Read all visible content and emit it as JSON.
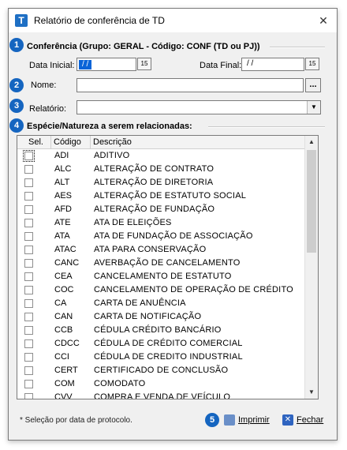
{
  "window": {
    "title": "Relatório de conferência de TD",
    "icon_letter": "T"
  },
  "badges": [
    "1",
    "2",
    "3",
    "4",
    "5"
  ],
  "section1": {
    "title": "Conferência (Grupo: GERAL - Código: CONF (TD ou PJ))",
    "data_inicial_label": "Data Inicial:",
    "data_inicial_value": " /  / ",
    "data_final_label": "Data Final:",
    "data_final_value": " /  / ",
    "calendar_glyph": "15"
  },
  "nome": {
    "label": "Nome:",
    "value": "",
    "browse_label": "..."
  },
  "relatorio": {
    "label": "Relatório:",
    "value": ""
  },
  "section4": {
    "title": "Espécie/Natureza a serem relacionadas:"
  },
  "grid": {
    "headers": {
      "sel": "Sel.",
      "codigo": "Código",
      "descricao": "Descrição"
    },
    "rows": [
      {
        "code": "ADI",
        "desc": "ADITIVO"
      },
      {
        "code": "ALC",
        "desc": "ALTERAÇÃO DE CONTRATO"
      },
      {
        "code": "ALT",
        "desc": "ALTERAÇÃO DE DIRETORIA"
      },
      {
        "code": "AES",
        "desc": "ALTERAÇÃO DE ESTATUTO SOCIAL"
      },
      {
        "code": "AFD",
        "desc": "ALTERAÇÃO DE FUNDAÇÃO"
      },
      {
        "code": "ATE",
        "desc": "ATA DE ELEIÇÕES"
      },
      {
        "code": "ATA",
        "desc": "ATA DE FUNDAÇÃO DE ASSOCIAÇÃO"
      },
      {
        "code": "ATAC",
        "desc": "ATA PARA CONSERVAÇÃO"
      },
      {
        "code": "CANC",
        "desc": "AVERBAÇÃO DE CANCELAMENTO"
      },
      {
        "code": "CEA",
        "desc": "CANCELAMENTO DE ESTATUTO"
      },
      {
        "code": "COC",
        "desc": "CANCELAMENTO DE OPERAÇÃO DE CRÉDITO"
      },
      {
        "code": "CA",
        "desc": "CARTA DE ANUÊNCIA"
      },
      {
        "code": "CAN",
        "desc": "CARTA DE NOTIFICAÇÃO"
      },
      {
        "code": "CCB",
        "desc": "CÉDULA CRÉDITO BANCÁRIO"
      },
      {
        "code": "CDCC",
        "desc": "CÉDULA DE CRÉDITO COMERCIAL"
      },
      {
        "code": "CCI",
        "desc": "CÉDULA DE CREDITO INDUSTRIAL"
      },
      {
        "code": "CERT",
        "desc": "CERTIFICADO DE CONCLUSÃO"
      },
      {
        "code": "COM",
        "desc": "COMODATO"
      },
      {
        "code": "CVV",
        "desc": "COMPRA E VENDA DE VEÍCULO"
      }
    ]
  },
  "footer": {
    "note": "* Seleção por data de protocolo.",
    "print_label": "Imprimir",
    "close_label": "Fechar"
  },
  "colors": {
    "accent": "#1565c0",
    "selection": "#0a64d8"
  },
  "icons": {
    "close": "close-icon",
    "print": "printer-icon",
    "fechar": "close-x-icon"
  }
}
